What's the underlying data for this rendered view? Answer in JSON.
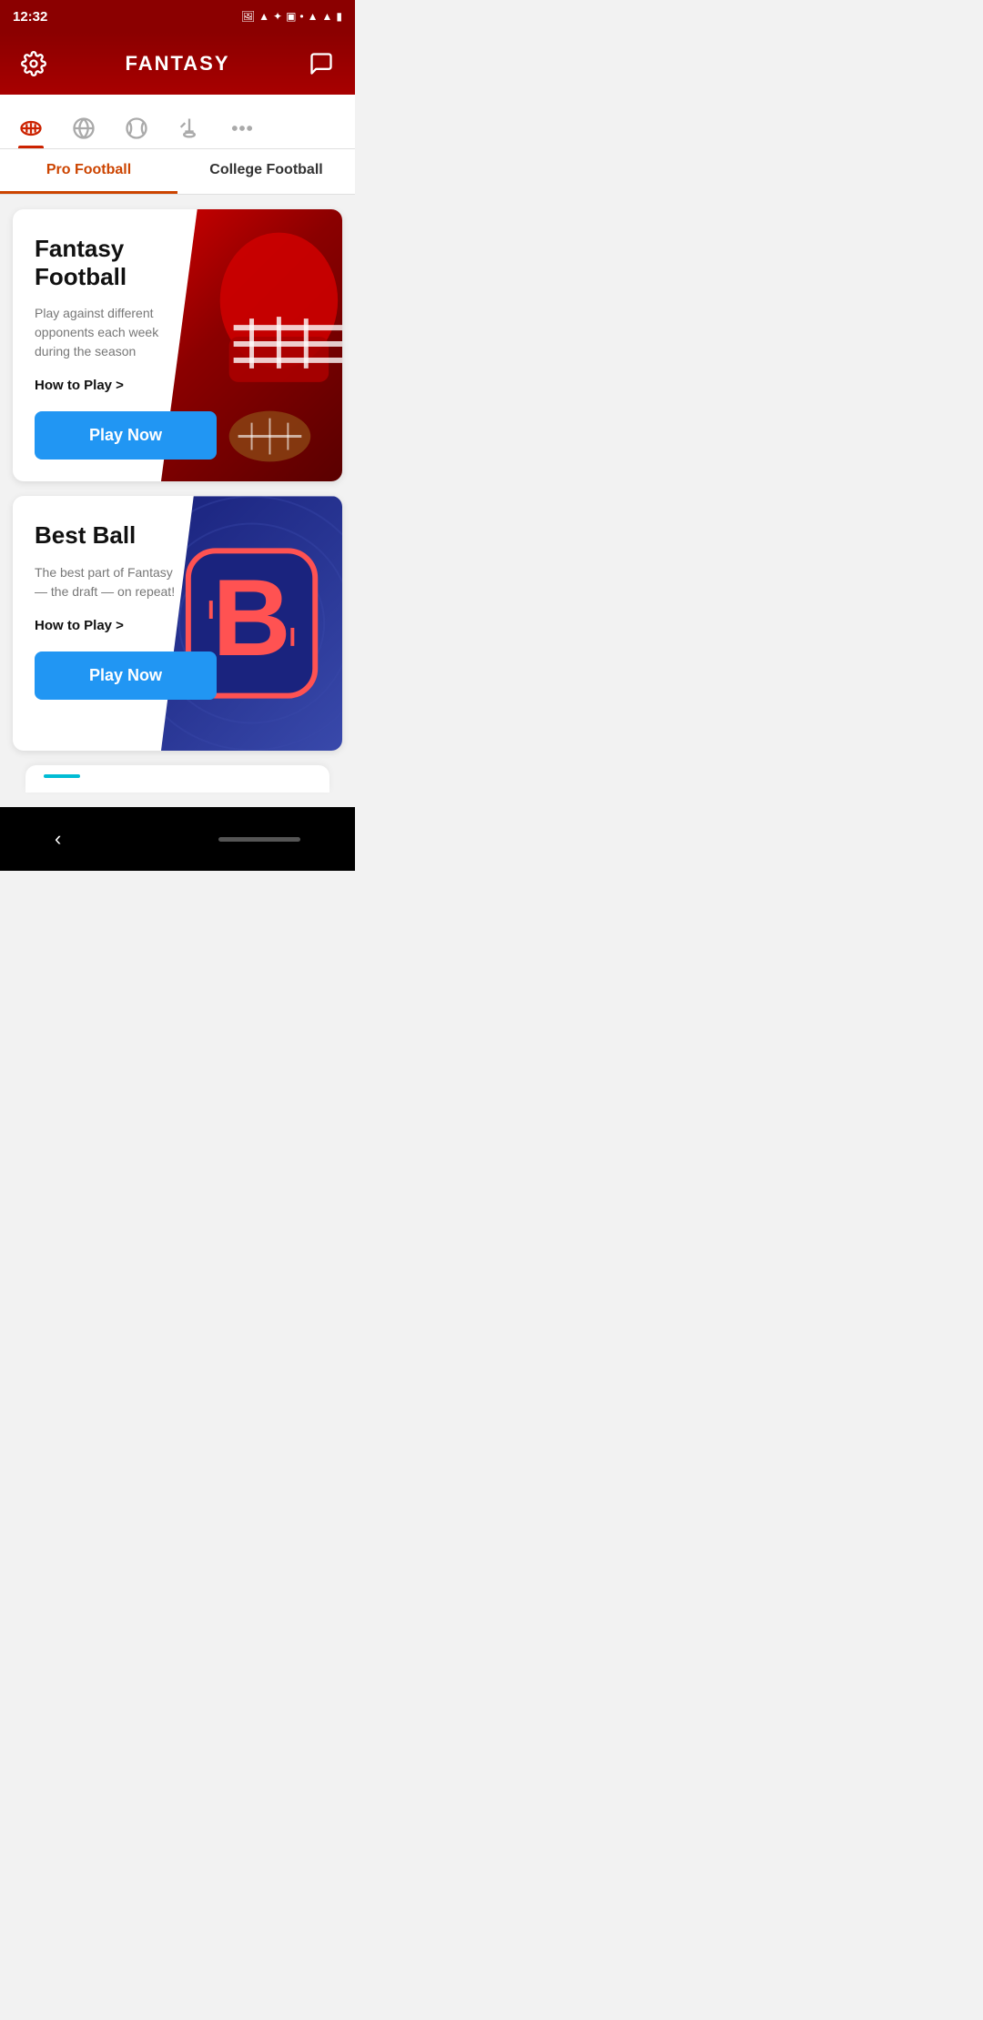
{
  "statusBar": {
    "time": "12:32",
    "icons": [
      "📷",
      "🔺",
      "✦",
      "📱",
      "•",
      "📶",
      "🔋"
    ]
  },
  "header": {
    "title": "FANTASY",
    "settingsIcon": "gear",
    "messageIcon": "message"
  },
  "sportTabs": [
    {
      "id": "football",
      "label": "Football",
      "active": true
    },
    {
      "id": "basketball",
      "label": "Basketball",
      "active": false
    },
    {
      "id": "baseball",
      "label": "Baseball",
      "active": false
    },
    {
      "id": "hockey",
      "label": "Hockey",
      "active": false
    },
    {
      "id": "more",
      "label": "More",
      "active": false
    }
  ],
  "subTabs": [
    {
      "id": "pro",
      "label": "Pro Football",
      "active": true
    },
    {
      "id": "college",
      "label": "College Football",
      "active": false
    }
  ],
  "cards": [
    {
      "id": "fantasy-football",
      "title": "Fantasy Football",
      "description": "Play against different opponents each week during the season",
      "howToPlay": "How to Play >",
      "playButton": "Play Now",
      "imageTheme": "red"
    },
    {
      "id": "best-ball",
      "title": "Best Ball",
      "description": "The best part of Fantasy — the draft — on repeat!",
      "howToPlay": "How to Play >",
      "playButton": "Play Now",
      "imageTheme": "blue"
    }
  ],
  "bottomNav": {
    "backLabel": "‹"
  },
  "colors": {
    "primary": "#8b0000",
    "accent": "#cc2200",
    "blue": "#2196f3",
    "activeTab": "#cc4400"
  }
}
